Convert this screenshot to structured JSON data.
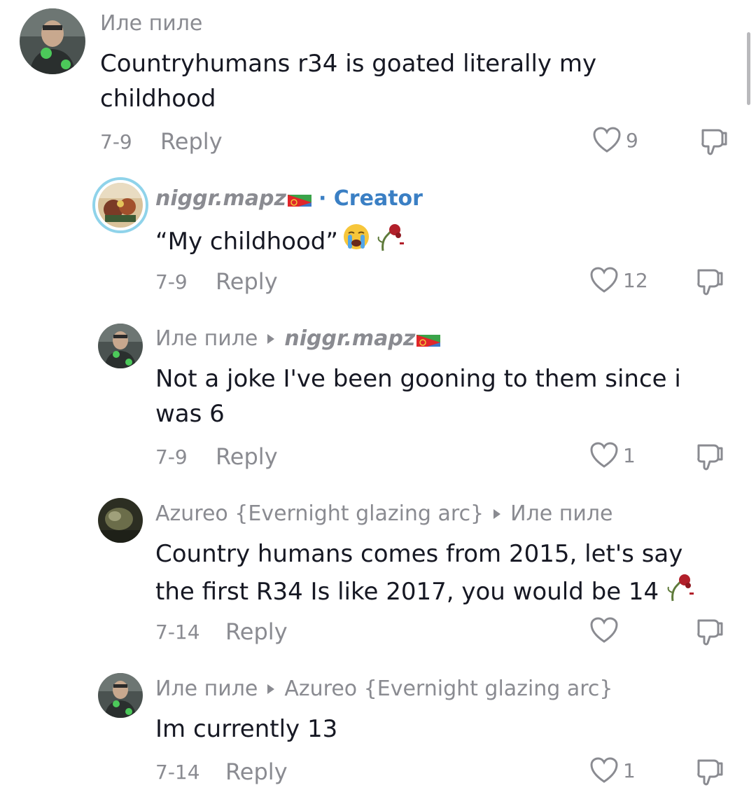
{
  "comments": [
    {
      "author": "Иле пиле",
      "text": "Countryhumans r34 is goated literally my childhood",
      "text_line1": "Countryhumans r34 is goated literally my",
      "text_line2": "childhood",
      "date": "7-9",
      "reply_label": "Reply",
      "likes": "9"
    },
    {
      "author": "niggr.mapz",
      "creator_label": "· Creator",
      "text": "“My childhood”",
      "date": "7-9",
      "reply_label": "Reply",
      "likes": "12"
    },
    {
      "author": "Иле пиле",
      "reply_to": "niggr.mapz",
      "text_line1": "Not a joke I've been gooning to them since i",
      "text_line2": "was 6",
      "date": "7-9",
      "reply_label": "Reply",
      "likes": "1"
    },
    {
      "author": "Azureo {Evernight glazing arc}",
      "reply_to": "Иле пиле",
      "text_line1": "Country humans comes from 2015, let's say",
      "text_line2": "the first R34 Is like 2017, you would be 14",
      "date": "7-14",
      "reply_label": "Reply",
      "likes": ""
    },
    {
      "author": "Иле пиле",
      "reply_to": "Azureo {Evernight glazing arc}",
      "text_line1": "Im currently 13",
      "date": "7-14",
      "reply_label": "Reply",
      "likes": "1"
    }
  ],
  "icons": {
    "like": "heart-outline-icon",
    "dislike": "thumbs-down-outline-icon",
    "reply_arrow": "caret-right-icon"
  },
  "colors": {
    "text": "#161823",
    "muted": "#8a8b91",
    "creator": "#3a7fc4",
    "creator_ring": "#8fd3ea"
  }
}
